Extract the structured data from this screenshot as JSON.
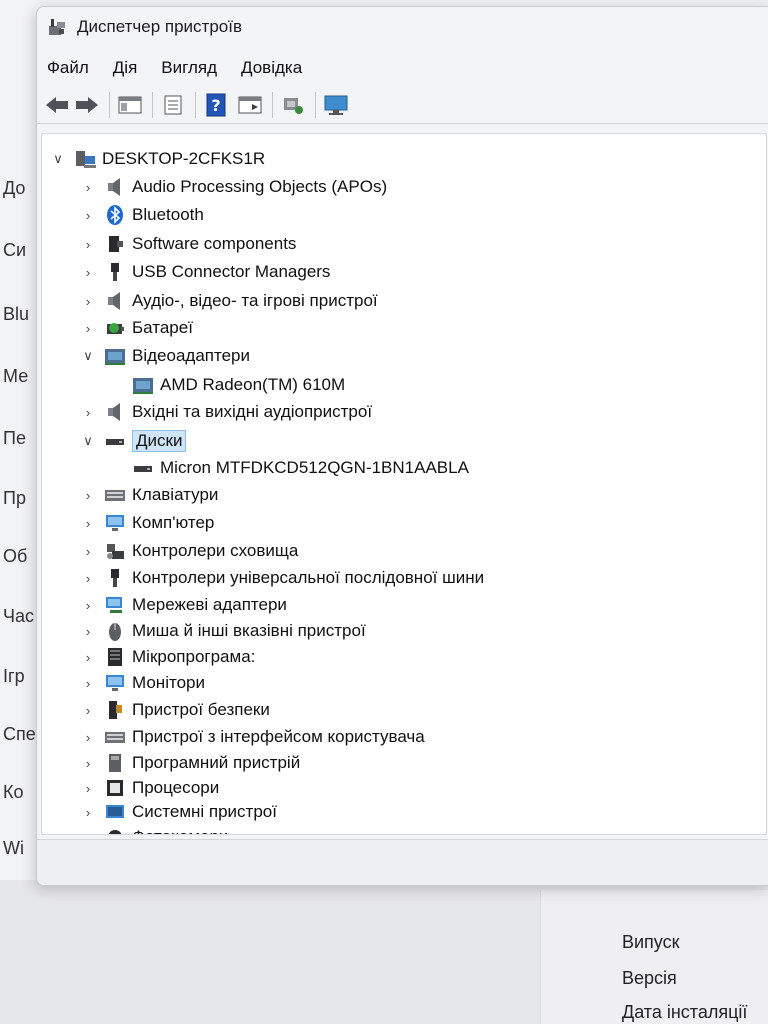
{
  "background": {
    "left_items": [
      "До",
      "Си",
      "Blu",
      "Ме",
      "Пе",
      "Пр",
      "Об",
      "Час",
      "Ігр",
      "Спе",
      "Ко",
      "Wi"
    ],
    "fields": [
      "Випуск",
      "Версія",
      "Дата інсталяції"
    ]
  },
  "window": {
    "title": "Диспетчер пристроїв",
    "menu": [
      "Файл",
      "Дія",
      "Вигляд",
      "Довідка"
    ]
  },
  "tree": {
    "root": "DESKTOP-2CFKS1R",
    "items": [
      {
        "label": "Audio Processing Objects (APOs)",
        "icon": "speaker-icon",
        "expanded": false
      },
      {
        "label": "Bluetooth",
        "icon": "bluetooth-icon",
        "expanded": false
      },
      {
        "label": "Software components",
        "icon": "software-component-icon",
        "expanded": false
      },
      {
        "label": "USB Connector Managers",
        "icon": "usb-connector-icon",
        "expanded": false
      },
      {
        "label": "Аудіо-, відео- та ігрові пристрої",
        "icon": "speaker-icon",
        "expanded": false
      },
      {
        "label": "Батареї",
        "icon": "battery-icon",
        "expanded": false
      },
      {
        "label": "Відеоадаптери",
        "icon": "display-adapter-icon",
        "expanded": true,
        "children": [
          "AMD Radeon(TM) 610M"
        ]
      },
      {
        "label": "Вхідні та вихідні аудіопристрої",
        "icon": "speaker-icon",
        "expanded": false
      },
      {
        "label": "Диски",
        "icon": "disk-drive-icon",
        "expanded": true,
        "selected": true,
        "children": [
          "Micron MTFDKCD512QGN-1BN1AABLA"
        ]
      },
      {
        "label": "Клавіатури",
        "icon": "keyboard-icon",
        "expanded": false
      },
      {
        "label": "Комп'ютер",
        "icon": "computer-icon",
        "expanded": false
      },
      {
        "label": "Контролери сховища",
        "icon": "storage-controller-icon",
        "expanded": false
      },
      {
        "label": "Контролери універсальної послідовної шини",
        "icon": "usb-icon",
        "expanded": false
      },
      {
        "label": "Мережеві адаптери",
        "icon": "network-adapter-icon",
        "expanded": false
      },
      {
        "label": "Миша й інші вказівні пристрої",
        "icon": "mouse-icon",
        "expanded": false
      },
      {
        "label": "Мікропрограма:",
        "icon": "firmware-icon",
        "expanded": false
      },
      {
        "label": "Монітори",
        "icon": "monitor-icon",
        "expanded": false
      },
      {
        "label": "Пристрої безпеки",
        "icon": "security-device-icon",
        "expanded": false
      },
      {
        "label": "Пристрої з інтерфейсом користувача",
        "icon": "hid-icon",
        "expanded": false
      },
      {
        "label": "Програмний пристрій",
        "icon": "software-device-icon",
        "expanded": false
      },
      {
        "label": "Процесори",
        "icon": "processor-icon",
        "expanded": false
      },
      {
        "label": "Системні пристрої",
        "icon": "system-device-icon",
        "expanded": false
      },
      {
        "label": "Фотокамери",
        "icon": "camera-icon",
        "expanded": false
      }
    ]
  }
}
